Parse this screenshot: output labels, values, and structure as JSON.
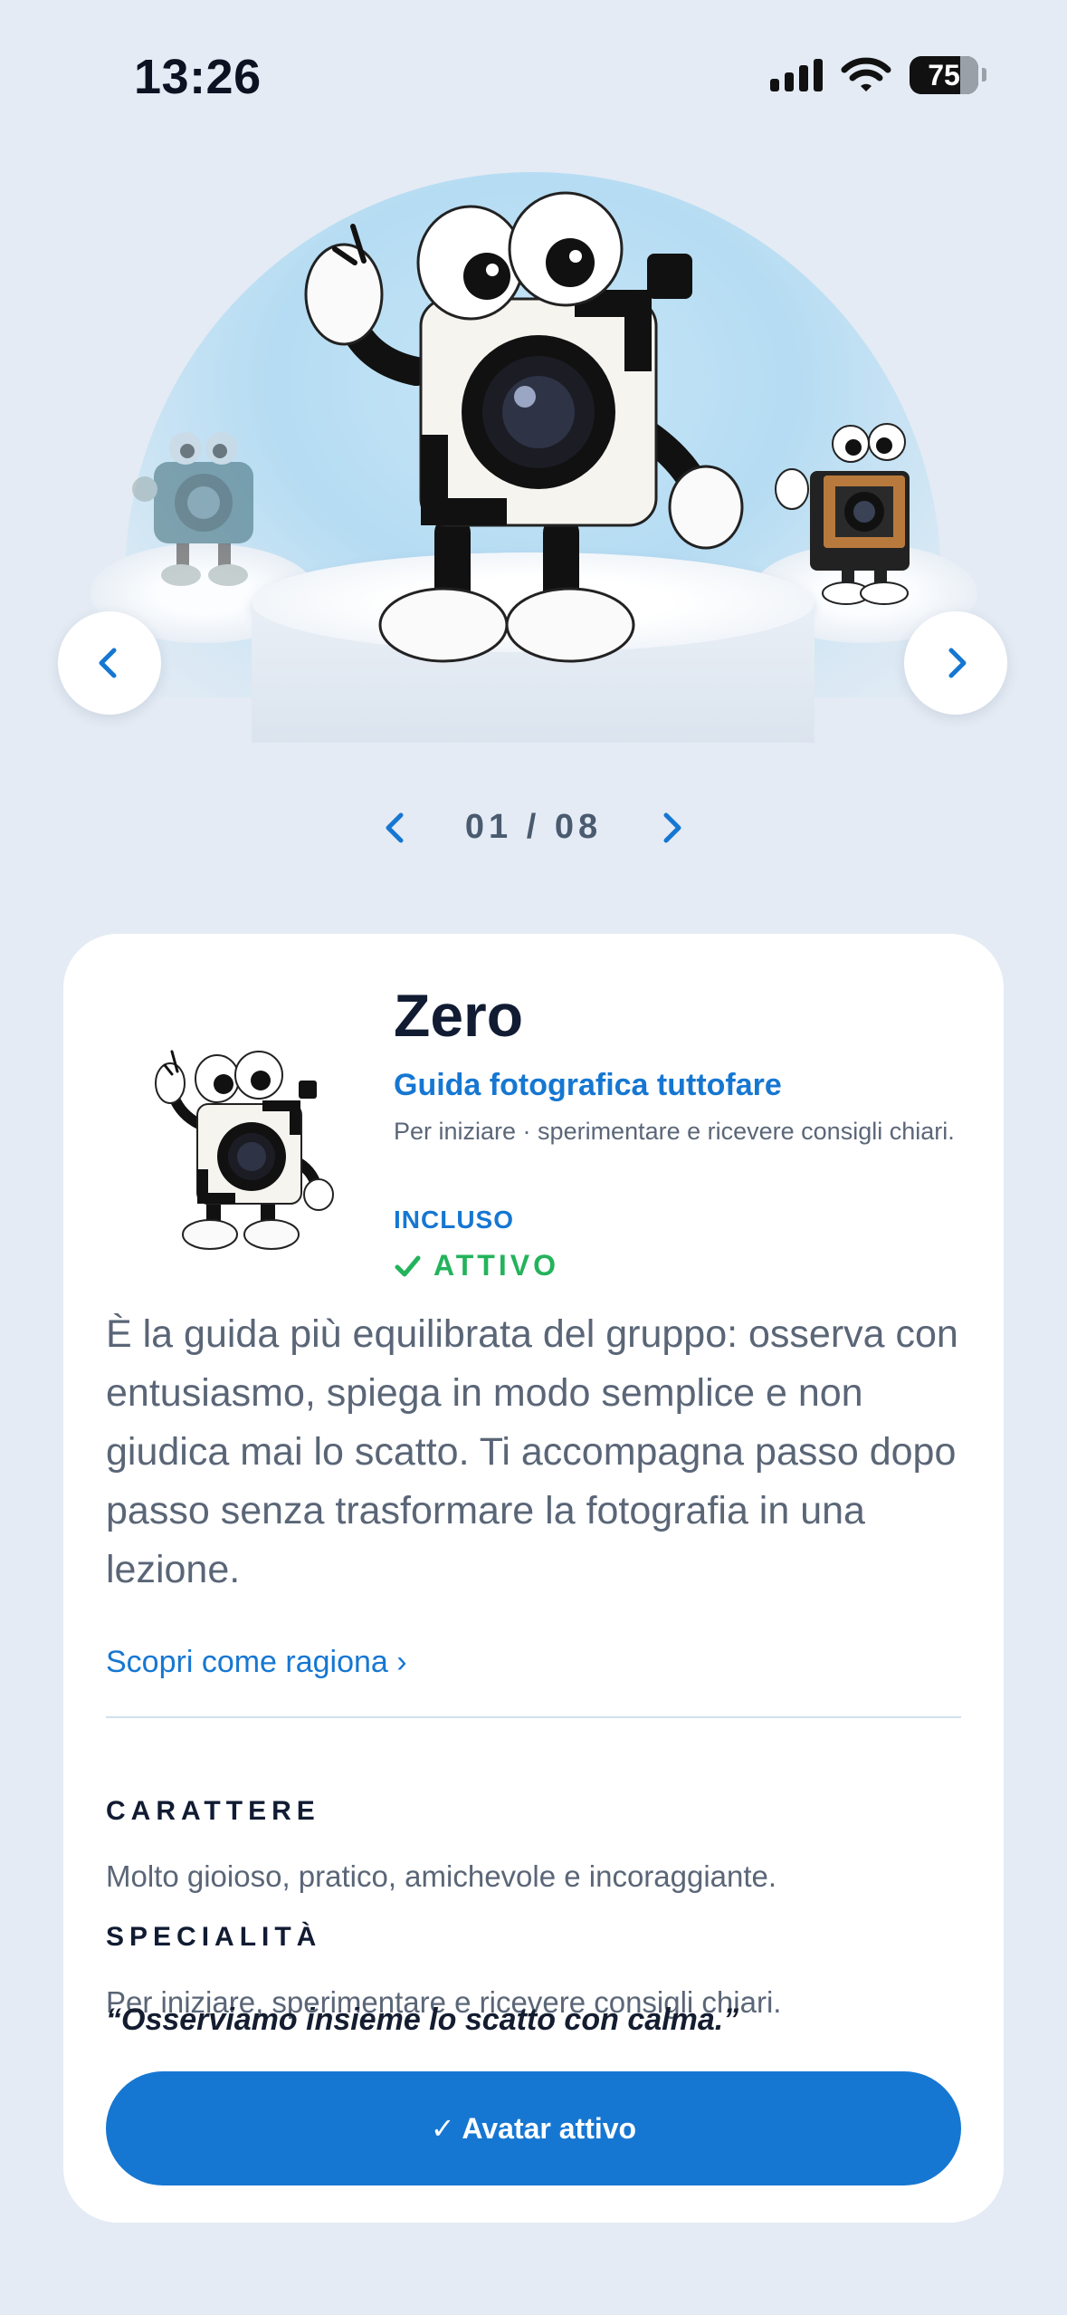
{
  "status": {
    "time": "13:26",
    "battery": "75"
  },
  "carousel": {
    "pager": "01 / 08"
  },
  "avatar": {
    "name": "Zero",
    "subtitle": "Guida fotografica tuttofare",
    "summary": "Per iniziare ·  sperimentare e ricevere consigli chiari.",
    "included_label": "INCLUSO",
    "active_label": "ATTIVO",
    "description": "È la guida più equilibrata del gruppo: osserva con entusiasmo, spiega in modo semplice e non giudica mai lo scatto. Ti accompagna passo dopo passo senza trasformare la fotografia in una lezione.",
    "discover_link": "Scopri come ragiona ›",
    "character_title": "CARATTERE",
    "character_text": "Molto gioioso, pratico, amichevole e incoraggiante.",
    "specialty_title": "SPECIALITÀ",
    "specialty_text": "Per iniziare, sperimentare e ricevere consigli chiari.",
    "quote": "“Osserviamo insieme lo scatto con calma.”",
    "cta_label": "✓ Avatar attivo"
  },
  "colors": {
    "accent": "#1677d2",
    "active": "#24b35c",
    "background": "#e4ebf4"
  },
  "icons": [
    "signal-icon",
    "wifi-icon",
    "battery-icon",
    "chevron-left-icon",
    "chevron-right-icon",
    "checkmark-icon"
  ]
}
